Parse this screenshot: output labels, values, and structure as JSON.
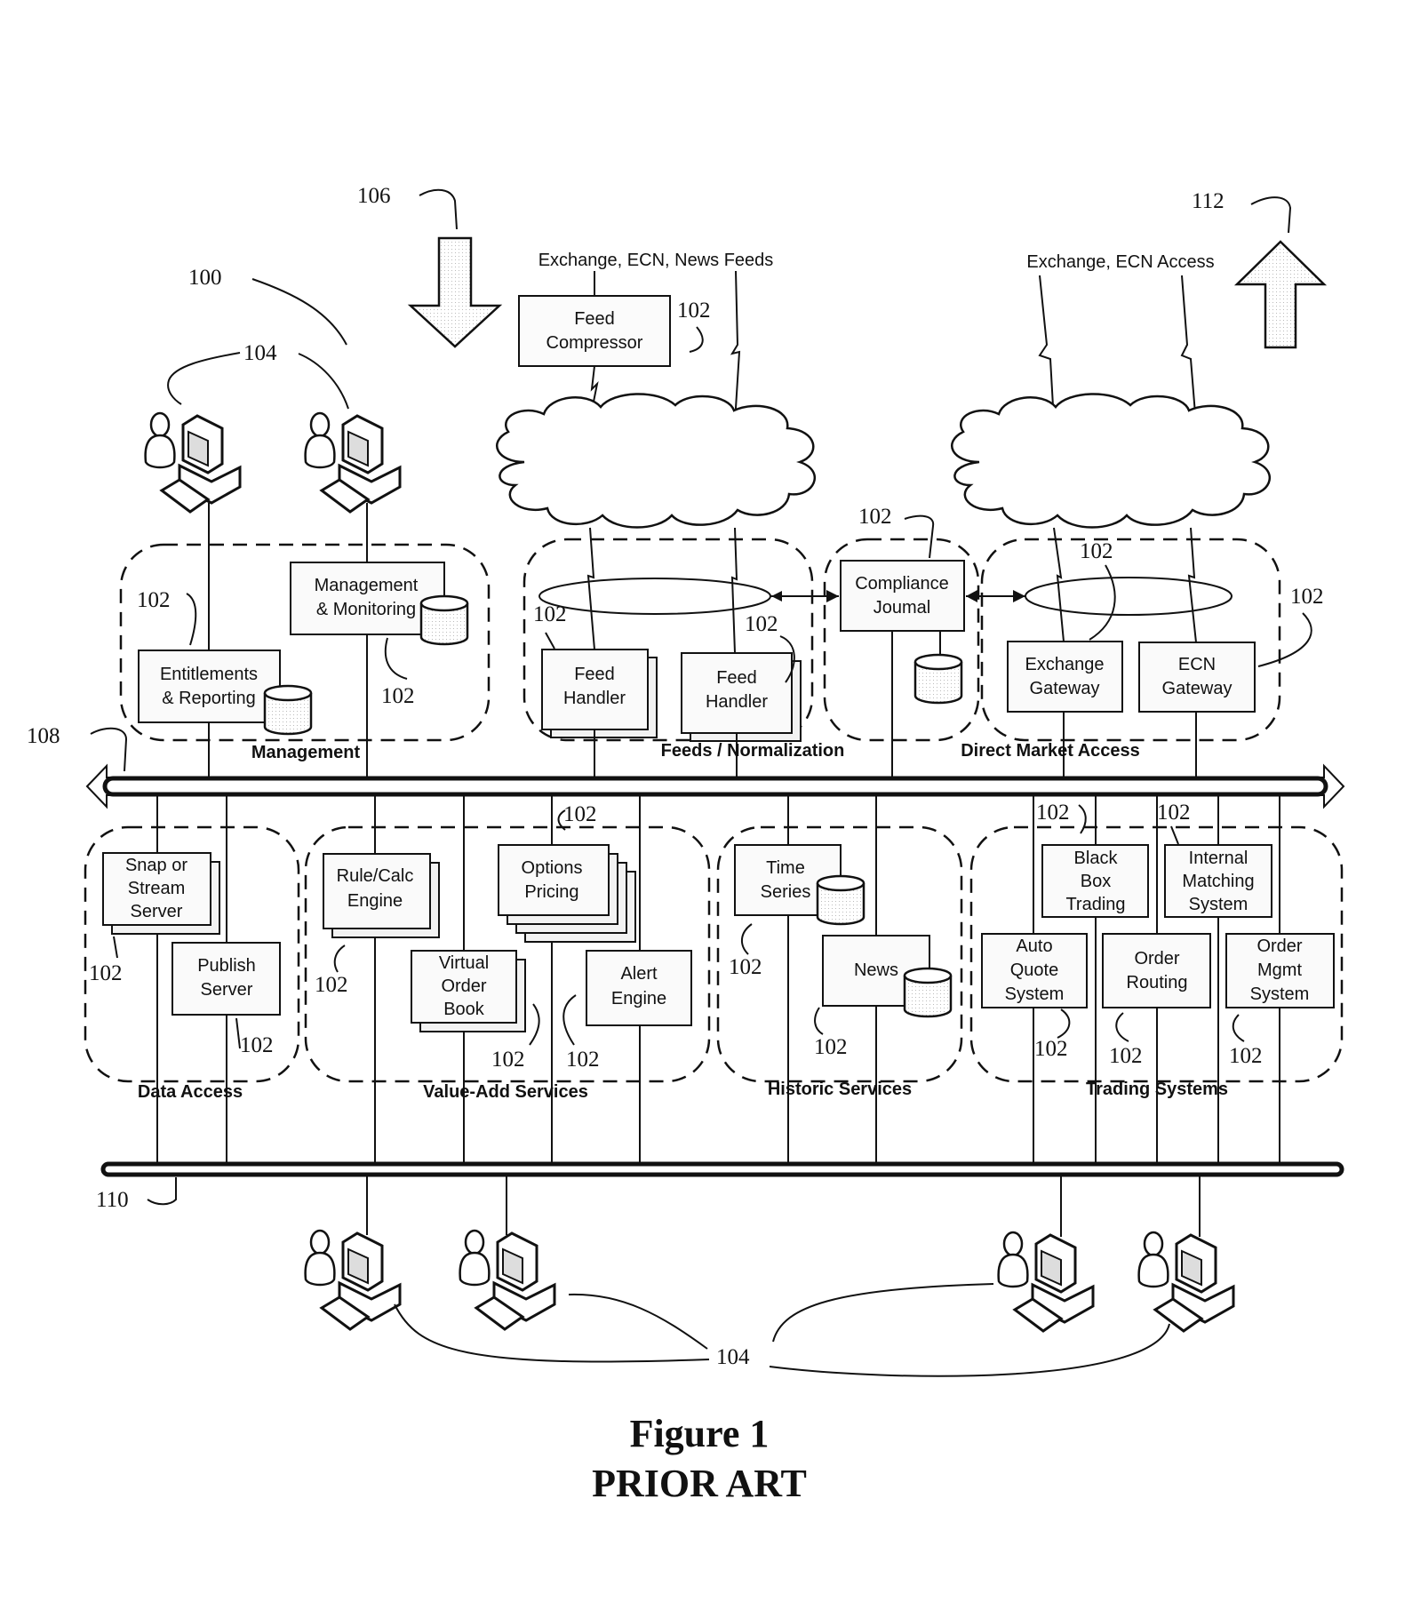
{
  "figure": {
    "caption_line1": "Figure 1",
    "caption_line2": "PRIOR ART"
  },
  "refs": {
    "system": "100",
    "node": "102",
    "user": "104",
    "inbound": "106",
    "bus_upper": "108",
    "bus_lower": "110",
    "outbound": "112"
  },
  "external": {
    "feeds_label": "Exchange, ECN, News Feeds",
    "access_label": "Exchange, ECN Access"
  },
  "groups": {
    "management": "Management",
    "feeds": "Feeds / Normalization",
    "dma": "Direct Market Access",
    "data_access": "Data Access",
    "value_add": "Value-Add Services",
    "historic": "Historic Services",
    "trading": "Trading Systems"
  },
  "components": {
    "feed_compressor": [
      "Feed",
      "Compressor"
    ],
    "mgmt_monitoring": [
      "Management",
      "& Monitoring"
    ],
    "entitlements": [
      "Entitlements",
      "& Reporting"
    ],
    "feed_handler_1": [
      "Feed",
      "Handler"
    ],
    "feed_handler_2": [
      "Feed",
      "Handler"
    ],
    "compliance": [
      "Compliance",
      "Joumal"
    ],
    "exchange_gateway": [
      "Exchange",
      "Gateway"
    ],
    "ecn_gateway": [
      "ECN",
      "Gateway"
    ],
    "snap_stream": [
      "Snap or",
      "Stream",
      "Server"
    ],
    "publish_server": [
      "Publish",
      "Server"
    ],
    "rule_calc": [
      "Rule/Calc",
      "Engine"
    ],
    "options_pricing": [
      "Options",
      "Pricing"
    ],
    "virtual_order_book": [
      "Virtual",
      "Order",
      "Book"
    ],
    "alert_engine": [
      "Alert",
      "Engine"
    ],
    "time_series": [
      "Time",
      "Series"
    ],
    "news": [
      "News"
    ],
    "black_box": [
      "Black",
      "Box",
      "Trading"
    ],
    "internal_matching": [
      "Internal",
      "Matching",
      "System"
    ],
    "auto_quote": [
      "Auto",
      "Quote",
      "System"
    ],
    "order_routing": [
      "Order",
      "Routing"
    ],
    "order_mgmt": [
      "Order",
      "Mgmt",
      "System"
    ]
  }
}
